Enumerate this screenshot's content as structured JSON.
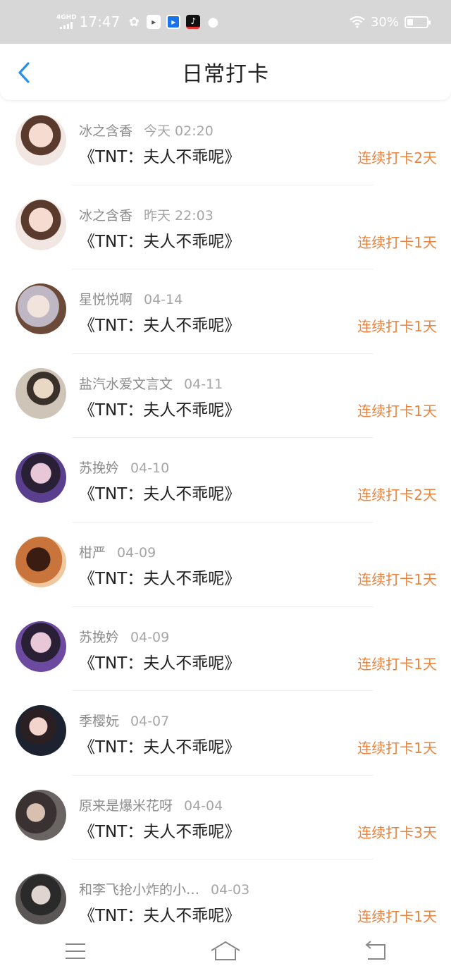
{
  "status_bar": {
    "network": "4GHD",
    "time": "17:47",
    "battery_percent": "30%",
    "battery_level": 0.3,
    "icons": [
      "wechat-icon",
      "app-icon",
      "app-icon",
      "tiktok-icon",
      "message-icon",
      "wifi-icon",
      "battery-icon"
    ]
  },
  "header": {
    "title": "日常打卡",
    "back_icon": "chevron-left-icon",
    "accent": "#2b8fe8"
  },
  "colors": {
    "streak": "#e9833d",
    "username": "#8c8c8c",
    "status_bar_bg": "#d7d7d7"
  },
  "checkins": [
    {
      "user": "冰之含香",
      "date": "今天 02:20",
      "book": "《TNT：夫人不乖呢》",
      "streak": "连续打卡2天"
    },
    {
      "user": "冰之含香",
      "date": "昨天 22:03",
      "book": "《TNT：夫人不乖呢》",
      "streak": "连续打卡1天"
    },
    {
      "user": "星悦悦啊",
      "date": "04-14",
      "book": "《TNT：夫人不乖呢》",
      "streak": "连续打卡1天"
    },
    {
      "user": "盐汽水爱文言文",
      "date": "04-11",
      "book": "《TNT：夫人不乖呢》",
      "streak": "连续打卡1天"
    },
    {
      "user": "苏挽妗",
      "date": "04-10",
      "book": "《TNT：夫人不乖呢》",
      "streak": "连续打卡2天"
    },
    {
      "user": "柑严",
      "date": "04-09",
      "book": "《TNT：夫人不乖呢》",
      "streak": "连续打卡1天"
    },
    {
      "user": "苏挽妗",
      "date": "04-09",
      "book": "《TNT：夫人不乖呢》",
      "streak": "连续打卡1天"
    },
    {
      "user": "季樱妧",
      "date": "04-07",
      "book": "《TNT：夫人不乖呢》",
      "streak": "连续打卡1天"
    },
    {
      "user": "原来是爆米花呀",
      "date": "04-04",
      "book": "《TNT：夫人不乖呢》",
      "streak": "连续打卡3天"
    },
    {
      "user": "和李飞抢小炸的小…",
      "date": "04-03",
      "book": "《TNT：夫人不乖呢》",
      "streak": "连续打卡1天"
    }
  ],
  "nav_bar": {
    "icons": [
      "menu-icon",
      "home-icon",
      "back-icon"
    ]
  }
}
